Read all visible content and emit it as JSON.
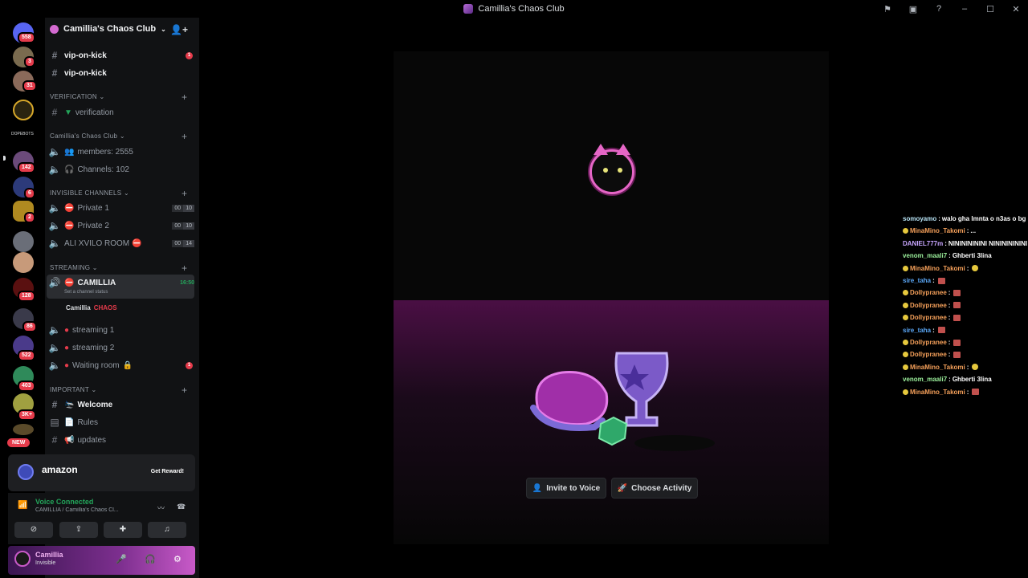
{
  "window": {
    "title": "Camillia's Chaos Club"
  },
  "rail": {
    "badges": [
      "558",
      "3",
      "31",
      "142",
      "6",
      "2",
      "128",
      "86",
      "522",
      "403",
      "3K+"
    ],
    "new_label": "NEW",
    "folder_label": "DOPEBOTS"
  },
  "server": {
    "name": "Camillia's Chaos Club",
    "channels_top": [
      {
        "name": "vip-on-kick",
        "unread": "1"
      },
      {
        "name": "vip-on-kick"
      }
    ],
    "cat_verification": "VERIFICATION",
    "verification": "verification",
    "cat_club": "Camillia's Chaos Club",
    "members": "members: 2555",
    "channels_count": "Channels: 102",
    "cat_invisible": "INVISIBLE CHANNELS",
    "private1": "Private 1",
    "private2": "Private 2",
    "ali_room": "ALI XVILO ROOM",
    "limit_zero": "00",
    "limit_ten": "10",
    "limit_14": "14",
    "cat_streaming": "STREAMING",
    "camillia_channel": "CAMILLIA",
    "camillia_timer": "16:50",
    "channel_status_placeholder": "Set a channel status",
    "voice_user": "Camillia",
    "voice_user_tag": "CHAOS",
    "streaming1": "streaming 1",
    "streaming2": "streaming 2",
    "waiting_room": "Waiting room",
    "waiting_unread": "1",
    "cat_important": "IMPORTANT",
    "welcome": "Welcome",
    "rules": "Rules",
    "updates": "updates"
  },
  "ad": {
    "brand": "amazon",
    "cta": "Get Reward!"
  },
  "voice": {
    "status": "Voice Connected",
    "channel": "CAMILLIA / Camillia's Chaos Cl..."
  },
  "user": {
    "name": "Camillia",
    "status": "Invisible"
  },
  "activity": {
    "invite_label": "Invite to Voice",
    "choose_label": "Choose Activity"
  },
  "chat": [
    {
      "user": "somoyamo",
      "text": "walo gha lmnta o n3as o bg",
      "color": "#b7e3f5"
    },
    {
      "user": "MinaMino_Takomi",
      "text": "...",
      "color": "#f5a05a",
      "badge": true
    },
    {
      "user": "DANIEL777m",
      "text": "NINININININI NINININININI",
      "color": "#c8a6ff"
    },
    {
      "user": "venom_maali7",
      "text": "Ghberti 3lina",
      "color": "#9df29d"
    },
    {
      "user": "MinaMino_Takomi",
      "text": "",
      "color": "#f5a05a",
      "badge": true,
      "emote": "y"
    },
    {
      "user": "sire_taha",
      "text": "",
      "color": "#5aa6f5",
      "emote": "r"
    },
    {
      "user": "Dollypranee",
      "text": "",
      "color": "#f5a05a",
      "badge": true,
      "emote": "r"
    },
    {
      "user": "Dollypranee",
      "text": "",
      "color": "#f5a05a",
      "badge": true,
      "emote": "r"
    },
    {
      "user": "Dollypranee",
      "text": "",
      "color": "#f5a05a",
      "badge": true,
      "emote": "r"
    },
    {
      "user": "sire_taha",
      "text": "",
      "color": "#5aa6f5",
      "emote": "r"
    },
    {
      "user": "Dollypranee",
      "text": "",
      "color": "#f5a05a",
      "badge": true,
      "emote": "r"
    },
    {
      "user": "Dollypranee",
      "text": "",
      "color": "#f5a05a",
      "badge": true,
      "emote": "r"
    },
    {
      "user": "MinaMino_Takomi",
      "text": "",
      "color": "#f5a05a",
      "badge": true,
      "emote": "y"
    },
    {
      "user": "venom_maali7",
      "text": "Ghberti 3lina",
      "color": "#9df29d"
    },
    {
      "user": "MinaMino_Takomi",
      "text": "",
      "color": "#f5a05a",
      "badge": true,
      "emote": "r"
    }
  ]
}
